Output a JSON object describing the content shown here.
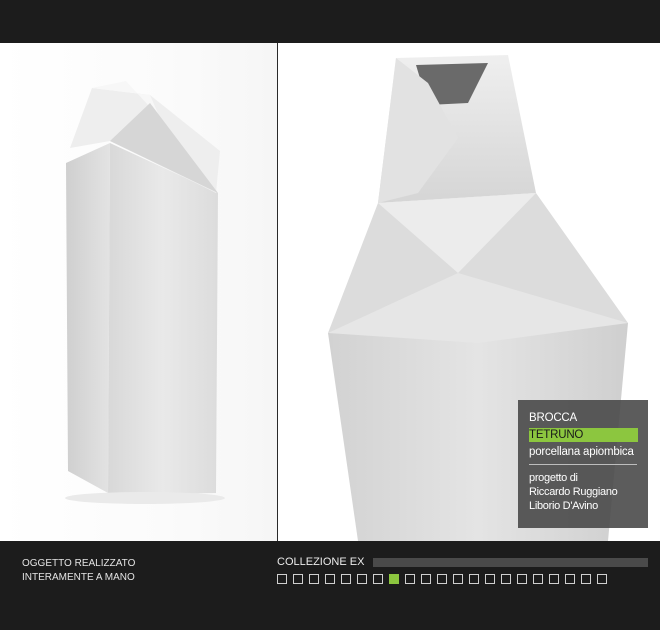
{
  "info": {
    "category": "BROCCA",
    "name": "TETRUNO",
    "material": "porcellana apiombica",
    "design_label": "progetto di",
    "designer_1": "Riccardo Ruggiano",
    "designer_2": "Liborio D'Avino"
  },
  "caption": {
    "line1": "OGGETTO REALIZZATO",
    "line2": "INTERAMENTE A MANO"
  },
  "collection": {
    "title": "COLLEZIONE EX",
    "thumbnail_count": 21,
    "active_index": 7
  },
  "colors": {
    "accent": "#8cc63f",
    "background": "#1c1c1c",
    "info_box": "#464646"
  }
}
